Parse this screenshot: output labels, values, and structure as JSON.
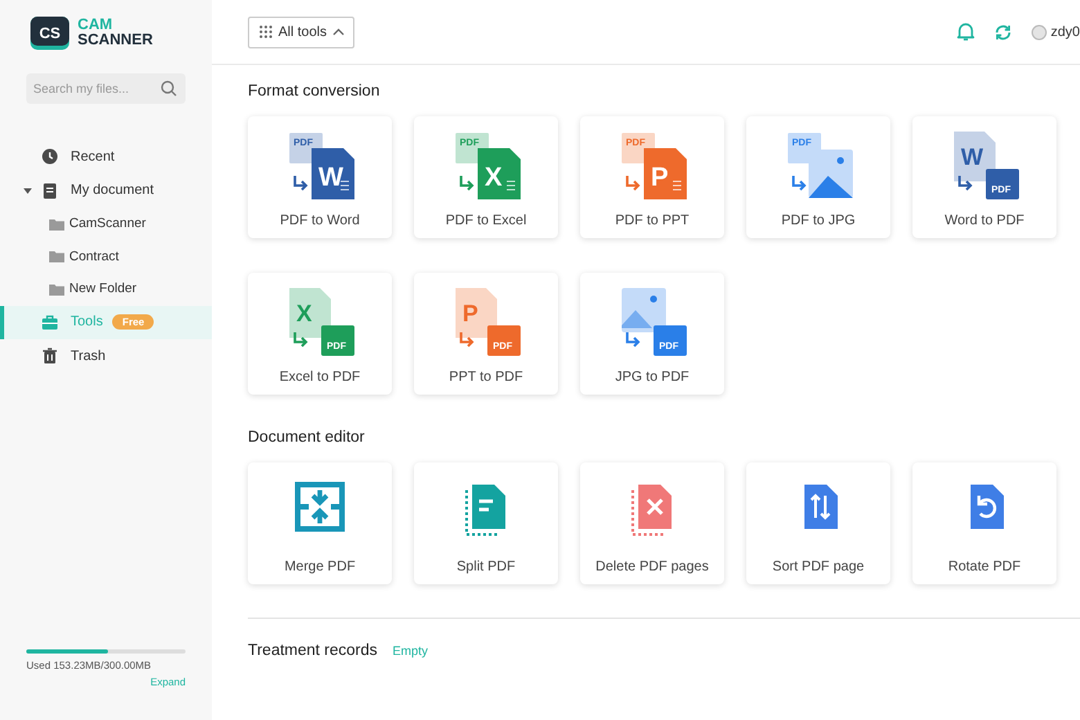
{
  "logo": {
    "mark": "CS",
    "line1": "CAM",
    "line2": "SCANNER"
  },
  "search": {
    "placeholder": "Search my files..."
  },
  "nav": [
    {
      "label": "Recent",
      "kind": "recent",
      "selected": false
    },
    {
      "label": "My document",
      "kind": "document",
      "selected": false,
      "expanded": true,
      "children": [
        {
          "label": "CamScanner",
          "kind": "folder",
          "selected": false
        },
        {
          "label": "Contract",
          "kind": "folder",
          "selected": false
        },
        {
          "label": "New Folder",
          "kind": "folder",
          "selected": false
        }
      ]
    },
    {
      "label": "Tools",
      "kind": "tools",
      "selected": true,
      "badge": "Free"
    },
    {
      "label": "Trash",
      "kind": "trash",
      "selected": false
    }
  ],
  "storage": {
    "level": 0.51,
    "text": "Used 153.23MB/300.00MB",
    "action": "Expand"
  },
  "header": {
    "menu": {
      "label": "All tools",
      "expanded": true
    },
    "user": "zdy0"
  },
  "sections": [
    {
      "title": "Format conversion",
      "tools": [
        {
          "label": "PDF to Word",
          "kind": "convert",
          "color": "#2f5ea8",
          "from": {
            "kind": "label",
            "text": "PDF"
          },
          "to": {
            "kind": "letter",
            "text": "W"
          }
        },
        {
          "label": "PDF to Excel",
          "kind": "convert",
          "color": "#1e9e5a",
          "from": {
            "kind": "label",
            "text": "PDF"
          },
          "to": {
            "kind": "letter",
            "text": "X"
          }
        },
        {
          "label": "PDF to PPT",
          "kind": "convert",
          "color": "#ee6a2c",
          "from": {
            "kind": "label",
            "text": "PDF"
          },
          "to": {
            "kind": "letter",
            "text": "P"
          }
        },
        {
          "label": "PDF to JPG",
          "kind": "convert",
          "color": "#2a7fe8",
          "from": {
            "kind": "label",
            "text": "PDF"
          },
          "to": {
            "kind": "image"
          }
        },
        {
          "label": "Word to PDF",
          "kind": "convert",
          "color": "#2f5ea8",
          "from": {
            "kind": "letter",
            "text": "W"
          },
          "to": {
            "kind": "label",
            "text": "PDF"
          }
        },
        {
          "label": "Excel to PDF",
          "kind": "convert",
          "color": "#1e9e5a",
          "from": {
            "kind": "letter",
            "text": "X"
          },
          "to": {
            "kind": "label",
            "text": "PDF"
          }
        },
        {
          "label": "PPT to PDF",
          "kind": "convert",
          "color": "#ee6a2c",
          "from": {
            "kind": "letter",
            "text": "P"
          },
          "to": {
            "kind": "label",
            "text": "PDF"
          }
        },
        {
          "label": "JPG to PDF",
          "kind": "convert",
          "color": "#2a7fe8",
          "from": {
            "kind": "image"
          },
          "to": {
            "kind": "label",
            "text": "PDF"
          }
        }
      ]
    },
    {
      "title": "Document editor",
      "tools": [
        {
          "label": "Merge PDF",
          "kind": "merge",
          "color": "#1996b8"
        },
        {
          "label": "Split PDF",
          "kind": "split",
          "color": "#14a3a0"
        },
        {
          "label": "Delete PDF pages",
          "kind": "delete",
          "color": "#f07878"
        },
        {
          "label": "Sort PDF page",
          "kind": "sort",
          "color": "#3f7ee6"
        },
        {
          "label": "Rotate PDF",
          "kind": "rotate",
          "color": "#3f7ee6"
        }
      ]
    }
  ],
  "records": {
    "title": "Treatment records",
    "status": "Empty"
  }
}
